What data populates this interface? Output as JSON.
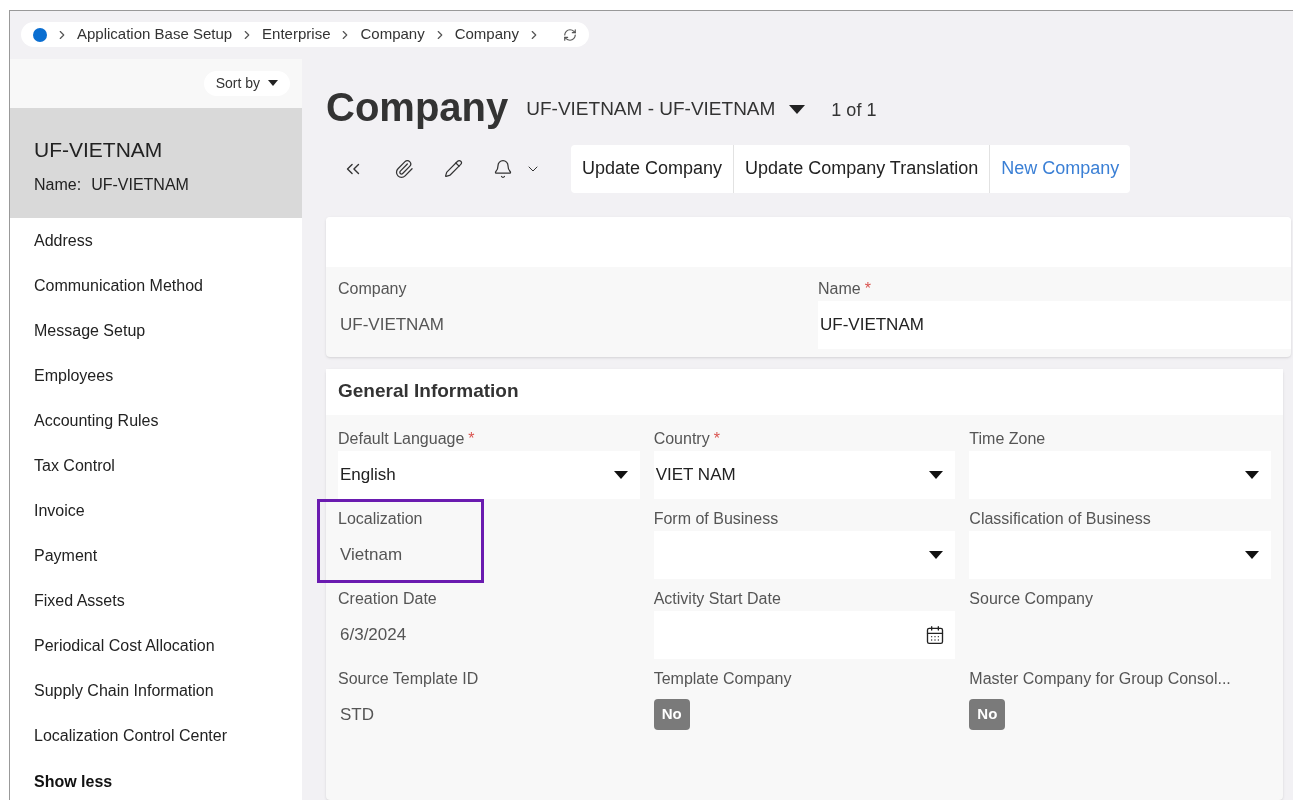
{
  "breadcrumb": [
    "Application Base Setup",
    "Enterprise",
    "Company",
    "Company"
  ],
  "sidebar": {
    "sort_label": "Sort by",
    "record": {
      "title": "UF-VIETNAM",
      "name_label": "Name:",
      "name_value": "UF-VIETNAM"
    },
    "items": [
      "Address",
      "Communication Method",
      "Message Setup",
      "Employees",
      "Accounting Rules",
      "Tax Control",
      "Invoice",
      "Payment",
      "Fixed Assets",
      "Periodical Cost Allocation",
      "Supply Chain Information",
      "Localization Control Center"
    ],
    "toggle_label": "Show less"
  },
  "header": {
    "title": "Company",
    "record": "UF-VIETNAM - UF-VIETNAM",
    "counter": "1 of 1"
  },
  "toolbar": {
    "buttons": [
      {
        "label": "Update Company",
        "primary": false
      },
      {
        "label": "Update Company Translation",
        "primary": false
      },
      {
        "label": "New Company",
        "primary": true
      }
    ]
  },
  "main_fields": [
    {
      "kind": "readonly",
      "label": "Company",
      "value": "UF-VIETNAM"
    },
    {
      "kind": "text",
      "label": "Name",
      "value": "UF-VIETNAM",
      "required_mark": "*"
    }
  ],
  "general": {
    "title": "General Information",
    "fields": [
      {
        "kind": "dropdown",
        "label": "Default Language",
        "value": "English",
        "required_mark": "*"
      },
      {
        "kind": "dropdown",
        "label": "Country",
        "value": "VIET NAM",
        "required_mark": "*"
      },
      {
        "kind": "dropdown",
        "label": "Time Zone"
      },
      {
        "kind": "readonly",
        "label": "Localization",
        "value": "Vietnam",
        "highlighted": true
      },
      {
        "kind": "dropdown",
        "label": "Form of Business"
      },
      {
        "kind": "dropdown",
        "label": "Classification of Business"
      },
      {
        "kind": "readonly",
        "label": "Creation Date",
        "value": "6/3/2024"
      },
      {
        "kind": "date",
        "label": "Activity Start Date"
      },
      {
        "kind": "readonly",
        "label": "Source Company"
      },
      {
        "kind": "readonly",
        "label": "Source Template ID",
        "value": "STD"
      },
      {
        "kind": "toggle",
        "label": "Template Company",
        "value": "No"
      },
      {
        "kind": "toggle",
        "label": "Master Company for Group Consol...",
        "value": "No"
      }
    ]
  }
}
